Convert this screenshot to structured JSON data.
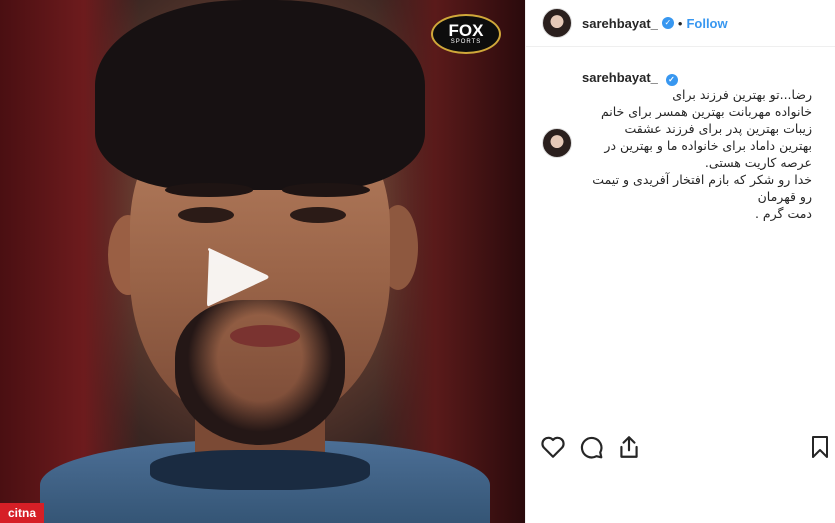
{
  "video": {
    "channel_logo": {
      "line1": "FOX",
      "line2": "SPORTS"
    },
    "watermark": "citna"
  },
  "header": {
    "username": "sarehbayat_",
    "separator": "•",
    "follow_label": "Follow"
  },
  "caption": {
    "username": "sarehbayat_",
    "lines": [
      "رضا...تو بهترین فرزند برای",
      "خانواده مهربانت بهترین همسر برای خانم",
      "زیبات بهترین پدر برای فرزند عشقت",
      "بهترین داماد برای خانواده ما و بهترین در",
      "عرصه کاریت هستی.",
      "خدا رو شکر که بازم افتخار آفریدی و تیمت",
      "رو قهرمان",
      "دمت گرم ."
    ]
  },
  "icons": [
    "heart-icon",
    "comment-icon",
    "share-icon",
    "bookmark-icon",
    "play-icon",
    "verified-icon"
  ],
  "colors": {
    "link": "#3897f0",
    "text": "#262626",
    "watermark": "#d61f26"
  }
}
